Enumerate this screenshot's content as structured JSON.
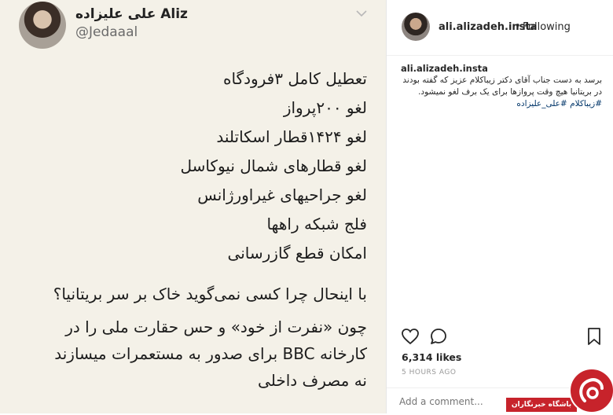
{
  "tweet": {
    "name": "علی علیزاده Aliz",
    "handle": "@Jedaaal",
    "lines": [
      "تعطیل کامل ۳فرودگاه",
      "لغو ۲۰۰پرواز",
      "لغو ۱۴۲۴قطار اسکاتلند",
      "لغو قطارهای شمال نیوکاسل",
      "لغو جراحیهای غیراورژانس",
      "فلج شبکه راهها",
      "امکان قطع گازرسانی"
    ],
    "question": "با اینحال چرا کسی نمی‌گوید خاک بر سر بریتانیا؟",
    "paragraph": [
      "چون «نفرت از خود» و حس حقارت ملی را در",
      "کارخانه BBC برای صدور به مستعمرات میسازند",
      "نه مصرف داخلی"
    ]
  },
  "instagram": {
    "username": "ali.alizadeh.insta",
    "separator": "•",
    "follow_label": "Following",
    "caption_user": "ali.alizadeh.insta",
    "caption_text": "برسد به دست جناب آقای دکتر زیباکلام عزیز که گفته بودند در بریتانیا هیچ وقت پروازها برای یک برف لغو نمیشود.",
    "hashtags": "#زیباکلام #علی_علیزاده",
    "likes": "6,314 likes",
    "time": "5 HOURS AGO",
    "comment_placeholder": "Add a comment..."
  },
  "watermark": {
    "text": "باشگاه خبرنگاران"
  },
  "colors": {
    "tweet_bg": "#f4f1e8",
    "hashtag": "#003569",
    "watermark_red": "#c7232b"
  },
  "icons": [
    "chevron-down-icon",
    "heart-icon",
    "comment-icon",
    "bookmark-icon"
  ]
}
